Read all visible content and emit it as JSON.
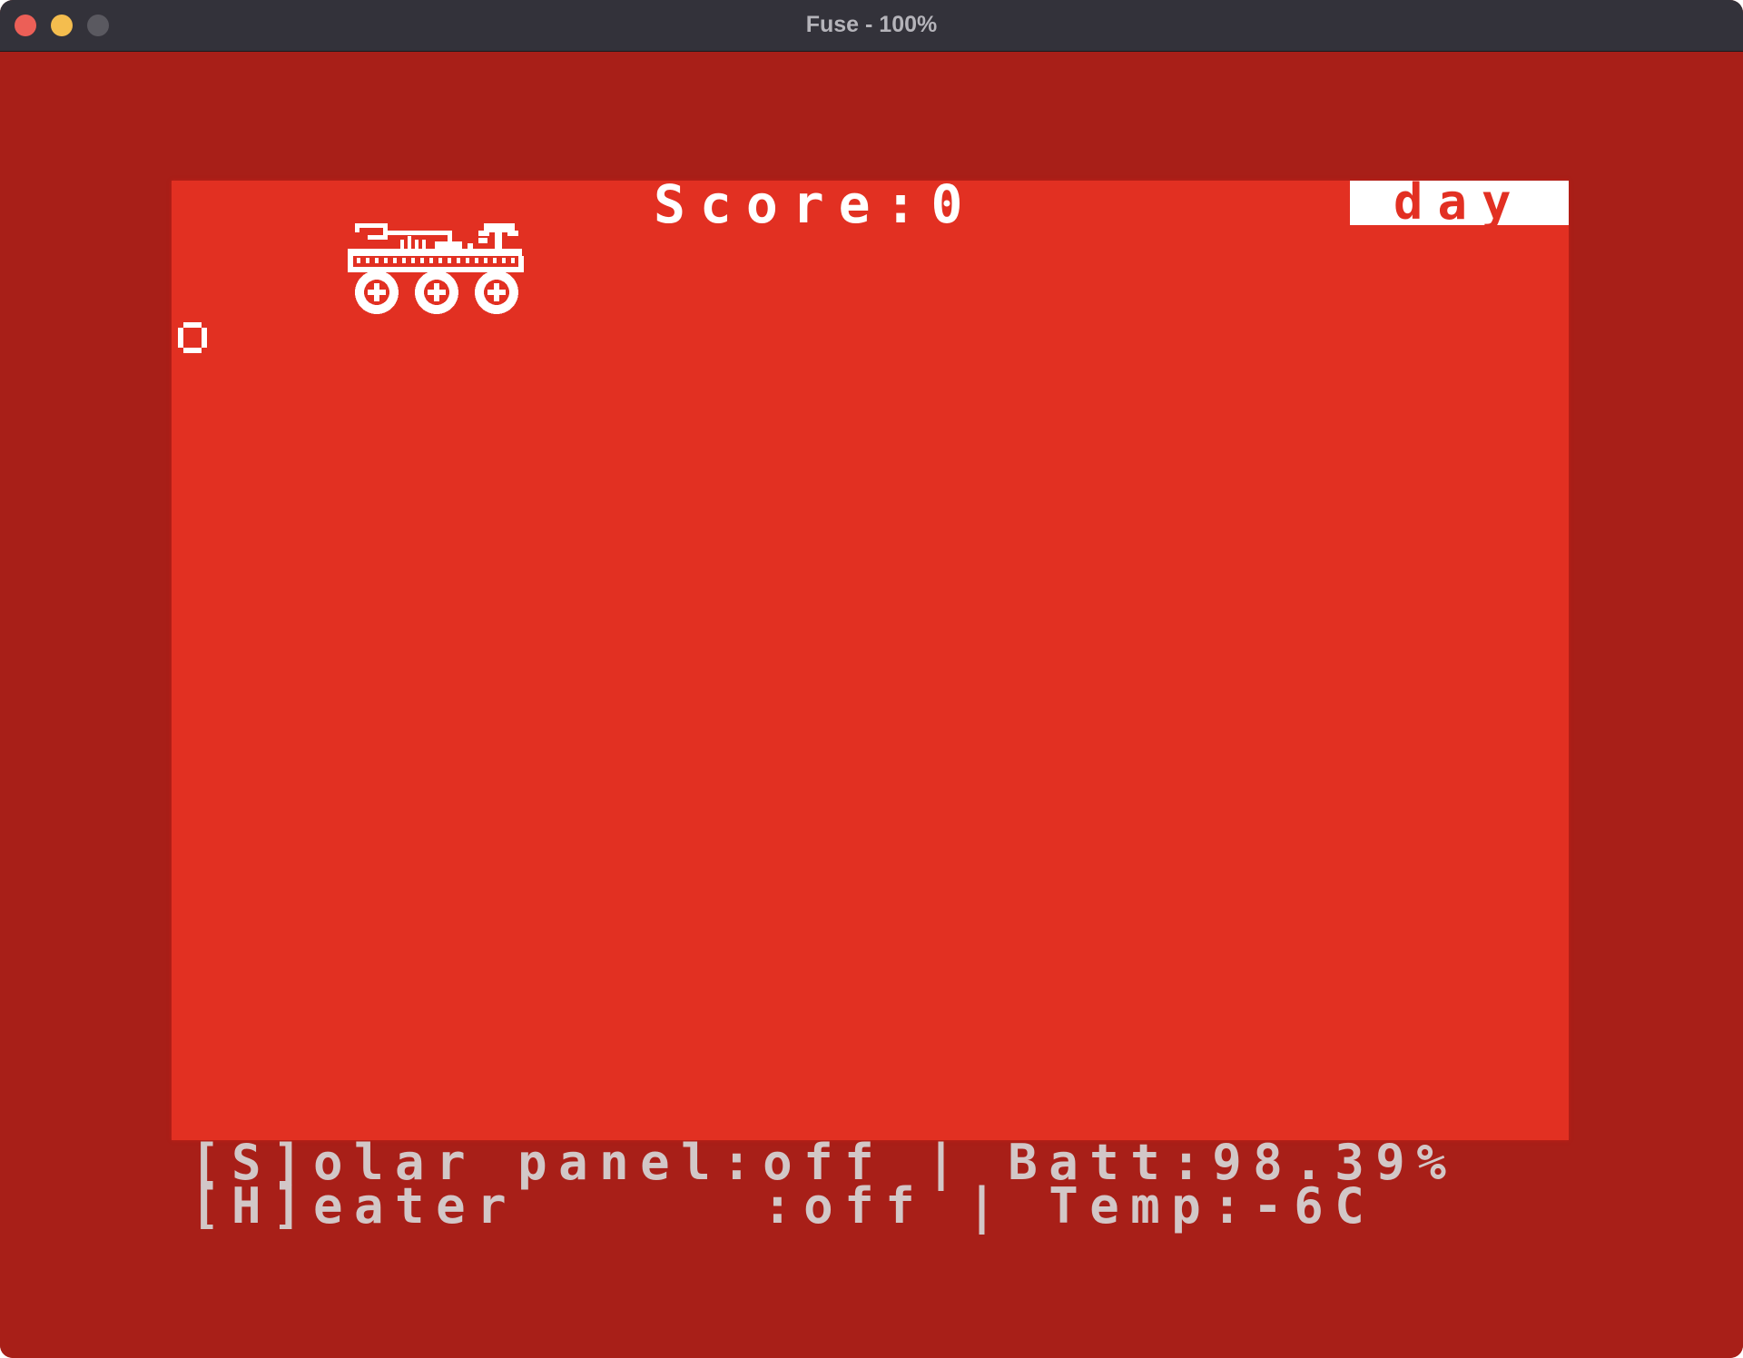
{
  "window": {
    "title": "Fuse - 100%"
  },
  "colors": {
    "border": "#a81f18",
    "paper": "#e23022",
    "ink": "#ffffff",
    "status_text": "#d2c7c7",
    "titlebar": "#33323a"
  },
  "game": {
    "score_text": "Score:0",
    "phase_label": "day",
    "sample_glyph": "rock-sample-icon",
    "status": {
      "line1": "[S]olar panel:off | Batt:98.39%",
      "line2": "[H]eater      :off | Temp:-6C"
    }
  }
}
